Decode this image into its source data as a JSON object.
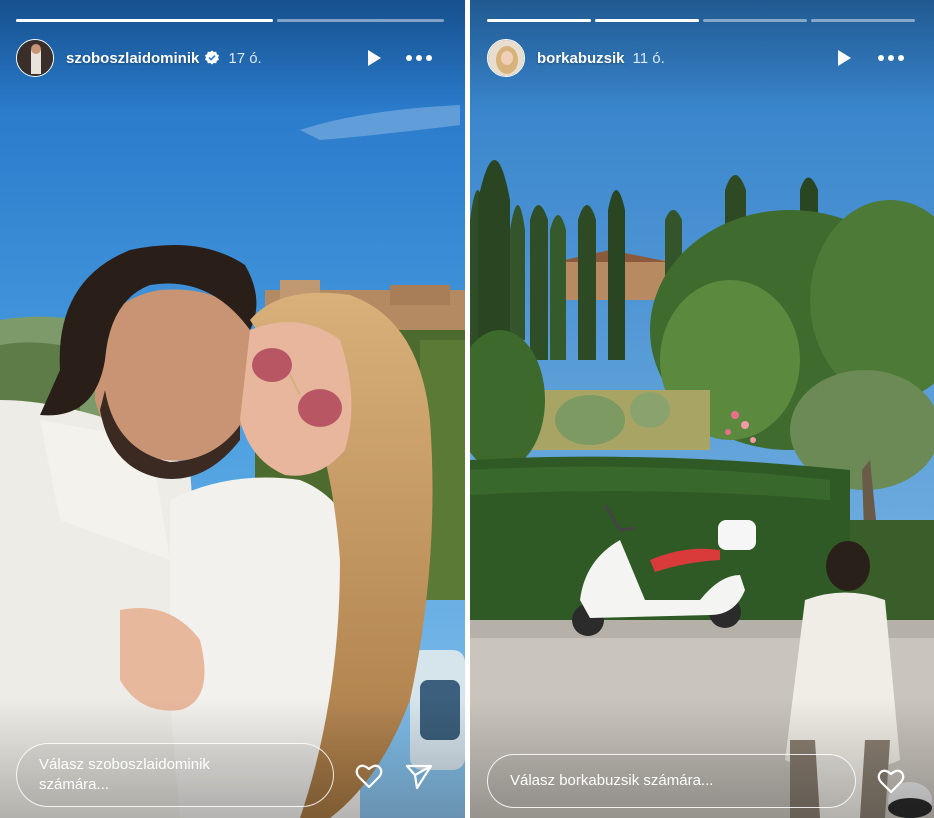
{
  "stories": [
    {
      "username": "szoboszlaidominik",
      "verified": true,
      "time": "17 ó.",
      "progress": [
        1.0,
        0.0
      ],
      "reply_placeholder": "Válasz szoboszlaidominik\nszámára...",
      "actions": [
        "heart-icon",
        "send-icon"
      ]
    },
    {
      "username": "borkabuzsik",
      "verified": false,
      "time": "11 ó.",
      "progress": [
        1.0,
        1.0,
        0.0,
        0.0
      ],
      "reply_placeholder": "Válasz borkabuzsik számára...",
      "actions": [
        "heart-icon"
      ]
    }
  ],
  "controls": [
    "play-icon",
    "more-options-icon"
  ],
  "colors": {
    "sky": "#3a8fd6",
    "verified": "#ffffff",
    "scooter_seat": "#d93a3a"
  }
}
